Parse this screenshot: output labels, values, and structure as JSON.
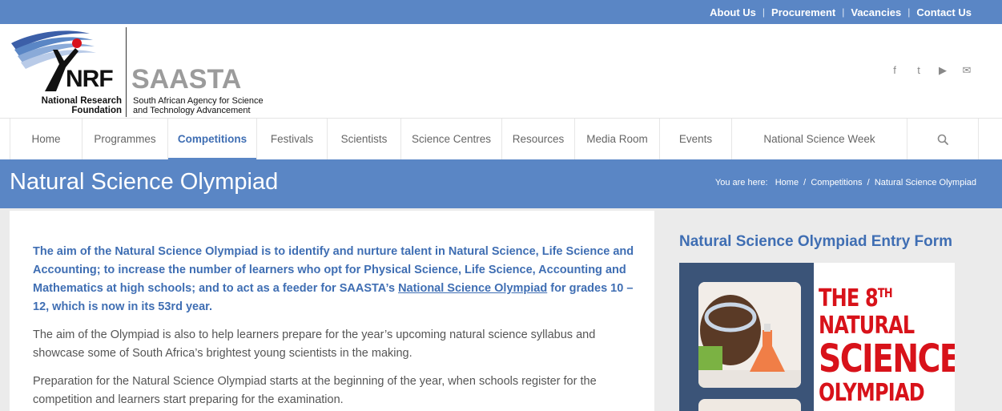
{
  "topbar": {
    "links": [
      "About Us",
      "Procurement",
      "Vacancies",
      "Contact Us"
    ],
    "bg_color": "#5a86c5"
  },
  "logo": {
    "nrf_word": "NRF",
    "nrf_sub_line1": "National Research",
    "nrf_sub_line2": "Foundation",
    "saasta_word": "SAASTA",
    "saasta_sub_line1": "South African Agency for Science",
    "saasta_sub_line2": "and Technology Advancement"
  },
  "social": {
    "icons": [
      "facebook-icon",
      "twitter-icon",
      "youtube-icon",
      "mail-icon"
    ],
    "glyphs": [
      "f",
      "t",
      "▶",
      "✉"
    ]
  },
  "nav": {
    "items": [
      "Home",
      "Programmes",
      "Competitions",
      "Festivals",
      "Scientists",
      "Science Centres",
      "Resources",
      "Media Room",
      "Events",
      "National Science Week"
    ],
    "active": "Competitions",
    "search_icon": "search-icon"
  },
  "title_band": {
    "title": "Natural Science Olympiad",
    "breadcrumb_prefix": "You are here:",
    "breadcrumb": [
      "Home",
      "Competitions",
      "Natural Science Olympiad"
    ]
  },
  "main": {
    "intro_part1": "The aim of the Natural Science Olympiad is to identify and nurture talent in Natural Science, Life Science and Accounting; to increase the number of learners who opt for Physical Science, Life Science, Accounting and Mathematics at high schools; and to act as a feeder for SAASTA’s ",
    "intro_link": "National Science Olympiad",
    "intro_part2": " for grades 10 – 12, which is now in its 53rd year.",
    "paragraph2": "The aim of the Olympiad is also to help learners prepare for the year’s upcoming natural science syllabus and showcase some of South Africa’s brightest young scientists in the making.",
    "paragraph3": "Preparation for the Natural Science Olympiad starts at the beginning of the year, when schools register for the competition and learners start preparing for the examination."
  },
  "sidebar": {
    "title": "Natural Science Olympiad Entry Form",
    "poster_line1": "THE 8",
    "poster_line1_sup": "TH",
    "poster_line2": "NATURAL",
    "poster_line3": "SCIENCE",
    "poster_line4": "OLYMPIAD"
  }
}
